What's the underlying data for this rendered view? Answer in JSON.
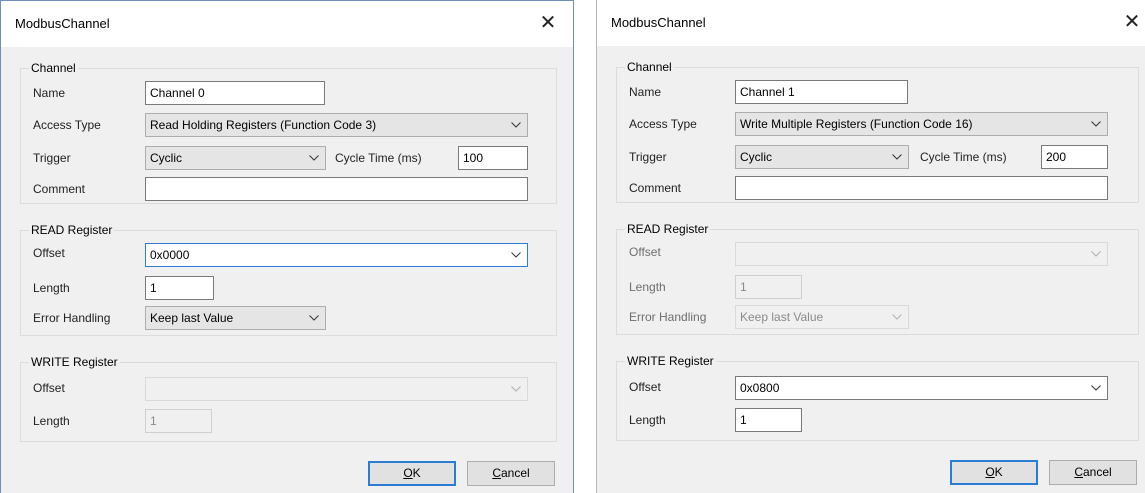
{
  "dialogs": [
    {
      "title": "ModbusChannel",
      "channel": {
        "group_title": "Channel",
        "name_label": "Name",
        "name_value": "Channel 0",
        "access_label": "Access Type",
        "access_value": "Read Holding Registers (Function Code 3)",
        "trigger_label": "Trigger",
        "trigger_value": "Cyclic",
        "cycle_label": "Cycle Time (ms)",
        "cycle_value": "100",
        "comment_label": "Comment",
        "comment_value": ""
      },
      "read": {
        "group_title": "READ Register",
        "offset_label": "Offset",
        "offset_value": "0x0000",
        "length_label": "Length",
        "length_value": "1",
        "error_label": "Error Handling",
        "error_value": "Keep last Value"
      },
      "write": {
        "group_title": "WRITE Register",
        "offset_label": "Offset",
        "offset_value": "",
        "length_label": "Length",
        "length_value": "1"
      },
      "ok_prefix": "",
      "ok_mnemonic": "O",
      "ok_suffix": "K",
      "cancel_mnemonic": "C",
      "cancel_suffix": "ancel"
    },
    {
      "title": "ModbusChannel",
      "channel": {
        "group_title": "Channel",
        "name_label": "Name",
        "name_value": "Channel 1",
        "access_label": "Access Type",
        "access_value": "Write Multiple Registers (Function Code 16)",
        "trigger_label": "Trigger",
        "trigger_value": "Cyclic",
        "cycle_label": "Cycle Time (ms)",
        "cycle_value": "200",
        "comment_label": "Comment",
        "comment_value": ""
      },
      "read": {
        "group_title": "READ Register",
        "offset_label": "Offset",
        "offset_value": "",
        "length_label": "Length",
        "length_value": "1",
        "error_label": "Error Handling",
        "error_value": "Keep last Value"
      },
      "write": {
        "group_title": "WRITE Register",
        "offset_label": "Offset",
        "offset_value": "0x0800",
        "length_label": "Length",
        "length_value": "1"
      },
      "ok_prefix": "",
      "ok_mnemonic": "O",
      "ok_suffix": "K",
      "cancel_mnemonic": "C",
      "cancel_suffix": "ancel"
    }
  ]
}
